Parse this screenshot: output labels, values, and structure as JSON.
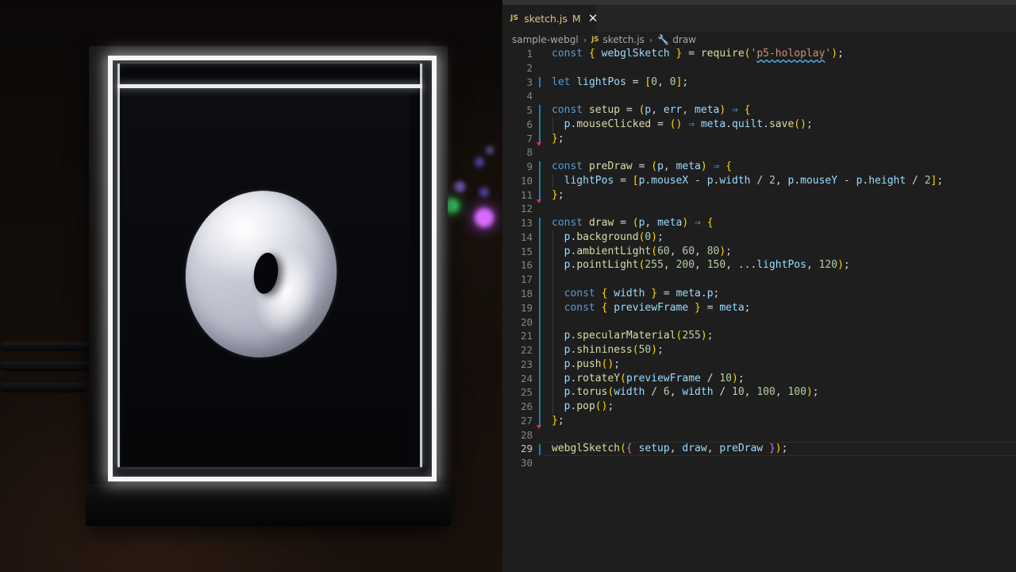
{
  "editor": {
    "tab": {
      "icon": "JS",
      "filename": "sketch.js",
      "status": "M"
    },
    "breadcrumb": {
      "folder": "sample-webgl",
      "file": "sketch.js",
      "symbol": "draw"
    },
    "active_line": 29,
    "lines": [
      {
        "n": "1",
        "text": "const { webglSketch } = require('p5-holoplay');"
      },
      {
        "n": "2",
        "text": ""
      },
      {
        "n": "3",
        "text": "let lightPos = [0, 0];"
      },
      {
        "n": "4",
        "text": ""
      },
      {
        "n": "5",
        "text": "const setup = (p, err, meta) ⇒ {"
      },
      {
        "n": "6",
        "text": "  p.mouseClicked = () ⇒ meta.quilt.save();"
      },
      {
        "n": "7",
        "text": "};"
      },
      {
        "n": "8",
        "text": ""
      },
      {
        "n": "9",
        "text": "const preDraw = (p, meta) ⇒ {"
      },
      {
        "n": "10",
        "text": "  lightPos = [p.mouseX - p.width / 2, p.mouseY - p.height / 2];"
      },
      {
        "n": "11",
        "text": "};"
      },
      {
        "n": "12",
        "text": ""
      },
      {
        "n": "13",
        "text": "const draw = (p, meta) ⇒ {"
      },
      {
        "n": "14",
        "text": "  p.background(0);"
      },
      {
        "n": "15",
        "text": "  p.ambientLight(60, 60, 80);"
      },
      {
        "n": "16",
        "text": "  p.pointLight(255, 200, 150, ...lightPos, 120);"
      },
      {
        "n": "17",
        "text": ""
      },
      {
        "n": "18",
        "text": "  const { width } = meta.p;"
      },
      {
        "n": "19",
        "text": "  const { previewFrame } = meta;"
      },
      {
        "n": "20",
        "text": ""
      },
      {
        "n": "21",
        "text": "  p.specularMaterial(255);"
      },
      {
        "n": "22",
        "text": "  p.shininess(50);"
      },
      {
        "n": "23",
        "text": "  p.push();"
      },
      {
        "n": "24",
        "text": "  p.rotateY(previewFrame / 10);"
      },
      {
        "n": "25",
        "text": "  p.torus(width / 6, width / 10, 100, 100);"
      },
      {
        "n": "26",
        "text": "  p.pop();"
      },
      {
        "n": "27",
        "text": "};"
      },
      {
        "n": "28",
        "text": ""
      },
      {
        "n": "29",
        "text": "webglSketch({ setup, draw, preDraw });"
      },
      {
        "n": "30",
        "text": ""
      }
    ]
  },
  "colors": {
    "keyword": "#569cd6",
    "function": "#dcdcaa",
    "variable": "#9cdcfe",
    "number": "#b5cea8",
    "string": "#ce9178",
    "modified_tab": "#e2c08d"
  }
}
